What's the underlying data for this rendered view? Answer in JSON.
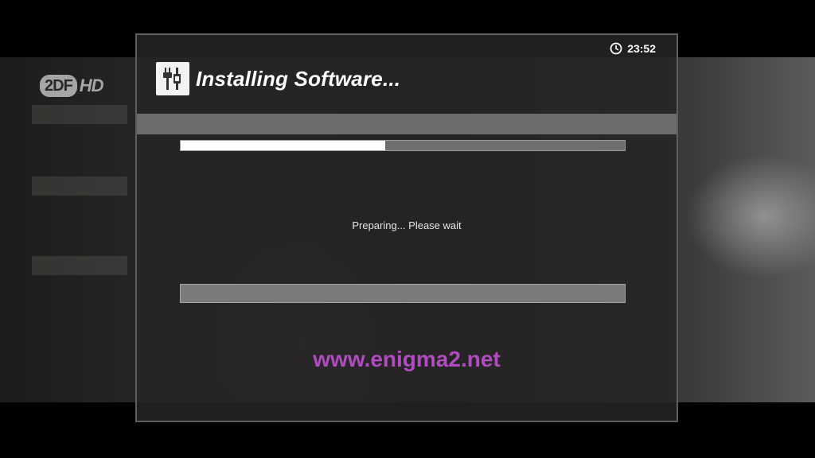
{
  "channel": {
    "logo_text_a": "2DF",
    "logo_text_b": "HD"
  },
  "dialog": {
    "clock_icon": "clock-icon",
    "time": "23:52",
    "title_icon": "plugin-connector-icon",
    "title": "Installing Software...",
    "progress_fraction": 0.46,
    "status": "Preparing... Please wait",
    "log_text": ""
  },
  "watermark": {
    "text": "www.enigma2.net",
    "color": "#b04bc0"
  },
  "colors": {
    "dialog_bg": "#262425",
    "header_bar": "#6c6c6c",
    "progress_fill": "#ffffff",
    "progress_track": "#6e6e6e"
  }
}
